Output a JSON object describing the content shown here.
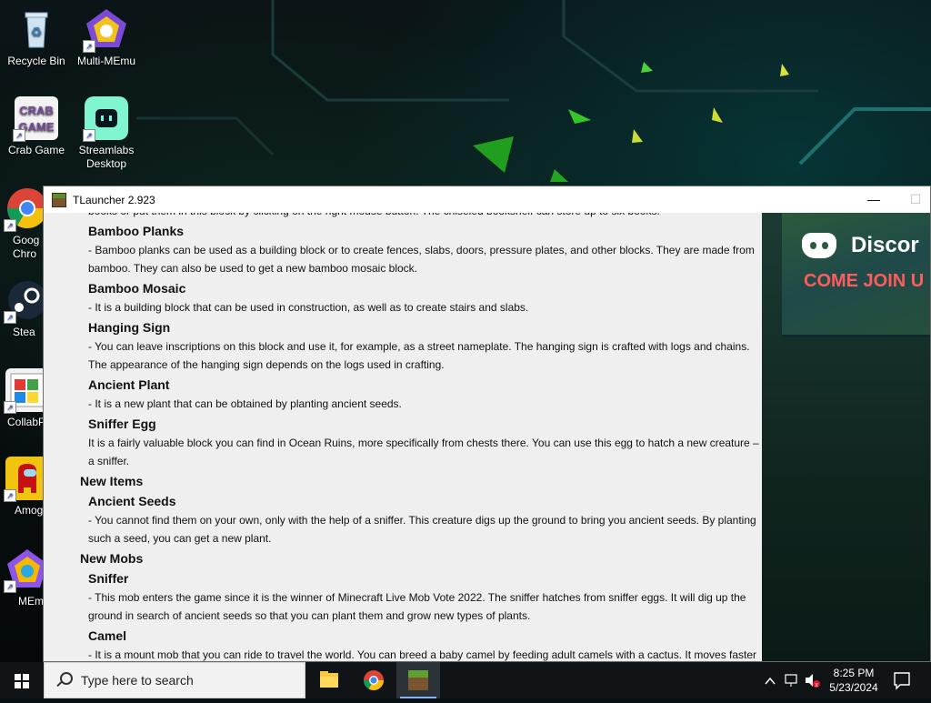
{
  "desktop": {
    "icons": [
      {
        "label": "Recycle Bin",
        "icon": "recycle-bin-icon"
      },
      {
        "label": "Multi-MEmu",
        "icon": "multi-memu-icon"
      },
      {
        "label": "Crab Game",
        "icon": "crab-game-icon"
      },
      {
        "label": "Streamlabs Desktop",
        "icon": "streamlabs-icon"
      },
      {
        "label": "Goog Chro",
        "icon": "google-chrome-icon"
      },
      {
        "label": "Stea",
        "icon": "steam-icon"
      },
      {
        "label": "CollabP",
        "icon": "collab-icon"
      },
      {
        "label": "Amog",
        "icon": "among-us-icon"
      },
      {
        "label": "MEm",
        "icon": "memu-icon"
      }
    ]
  },
  "window": {
    "title": "TLauncher 2.923",
    "minimize_label": "—",
    "maximize_label": "☐"
  },
  "content": {
    "intro": "books or put them in this block by clicking on the right mouse button. The chiseled bookshelf can store up to six books.",
    "blocks": [
      {
        "heading": "Bamboo Planks",
        "text": "- Bamboo planks can be used as a building block or to create fences, slabs, doors, pressure plates, and other blocks. They are made from bamboo. They can also be used to get a new bamboo mosaic block."
      },
      {
        "heading": "Bamboo Mosaic",
        "text": "- It is a building block that can be used in construction, as well as to create stairs and slabs."
      },
      {
        "heading": "Hanging Sign",
        "text": "- You can leave inscriptions on this block and use it, for example, as a street nameplate. The hanging sign is crafted with logs and chains. The appearance of the hanging sign depends on the logs used in crafting."
      },
      {
        "heading": "Ancient Plant",
        "text": "- It is a new plant that can be obtained by planting ancient seeds."
      },
      {
        "heading": "Sniffer Egg",
        "text": "It is a fairly valuable block you can find in Ocean Ruins, more specifically from chests there. You can use this egg to hatch a new creature – a sniffer."
      }
    ],
    "items_section": "New Items",
    "items": [
      {
        "heading": "Ancient Seeds",
        "text": "- You cannot find them on your own, only with the help of a sniffer. This creature digs up the ground to bring you ancient seeds. By planting such a seed, you can get a new plant."
      }
    ],
    "mobs_section": "New Mobs",
    "mobs": [
      {
        "heading": "Sniffer",
        "text": "- This mob enters the game since it is the winner of Minecraft Live Mob Vote 2022. The sniffer hatches from sniffer eggs. It will dig up the ground in search of ancient seeds so that you can plant them and grow new types of plants."
      },
      {
        "heading": "Camel",
        "text": "- It is a mount mob that you can ride to travel the world. You can breed a baby camel by feeding adult camels with a cactus. It moves faster than a horse and it walks on sand. It can carry up to two players."
      }
    ]
  },
  "side_panel": {
    "discord_name": "Discor",
    "discord_cta": "COME JOIN U"
  },
  "taskbar": {
    "search_placeholder": "Type here to search",
    "time": "8:25 PM",
    "date": "5/23/2024",
    "apps": [
      "file-explorer-icon",
      "chrome-icon",
      "tlauncher-icon"
    ]
  }
}
